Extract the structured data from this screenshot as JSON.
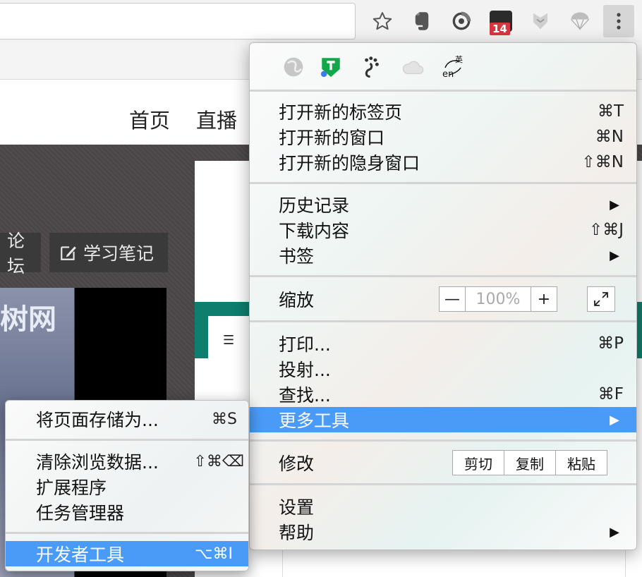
{
  "toolbar": {
    "badge_count": "14",
    "icons": [
      "star-icon",
      "evernote-icon",
      "sync-icon",
      "extension-badge-icon",
      "shield-icon",
      "parachute-icon",
      "menu-dots-icon"
    ]
  },
  "page": {
    "nav": [
      "首页",
      "直播"
    ],
    "buttons": [
      "论坛",
      "学习笔记"
    ],
    "photo_text": "树网"
  },
  "menu": {
    "extension_icons": [
      "ball-icon",
      "tampermonkey-icon",
      "paw-icon",
      "cloud-icon",
      "translate-icon"
    ],
    "translate_label_top": "英",
    "translate_label_bottom": "en",
    "group1": [
      {
        "label": "打开新的标签页",
        "shortcut": "⌘T"
      },
      {
        "label": "打开新的窗口",
        "shortcut": "⌘N"
      },
      {
        "label": "打开新的隐身窗口",
        "shortcut": "⇧⌘N"
      }
    ],
    "group2": [
      {
        "label": "历史记录",
        "arrow": "▶"
      },
      {
        "label": "下载内容",
        "shortcut": "⇧⌘J"
      },
      {
        "label": "书签",
        "arrow": "▶"
      }
    ],
    "zoom": {
      "label": "缩放",
      "minus": "—",
      "value": "100%",
      "plus": "+"
    },
    "group4": [
      {
        "label": "打印...",
        "shortcut": "⌘P"
      },
      {
        "label": "投射..."
      },
      {
        "label": "查找...",
        "shortcut": "⌘F"
      },
      {
        "label": "更多工具",
        "arrow": "▶"
      }
    ],
    "edit": {
      "label": "修改",
      "cut": "剪切",
      "copy": "复制",
      "paste": "粘贴"
    },
    "group6": [
      {
        "label": "设置"
      },
      {
        "label": "帮助",
        "arrow": "▶"
      }
    ]
  },
  "submenu": {
    "items": [
      {
        "label": "将页面存储为...",
        "shortcut": "⌘S"
      },
      {
        "label": "清除浏览数据...",
        "shortcut": "⇧⌘⌫"
      },
      {
        "label": "扩展程序"
      },
      {
        "label": "任务管理器"
      },
      {
        "label": "开发者工具",
        "shortcut": "⌥⌘I"
      }
    ]
  },
  "colors": {
    "highlight": "#4a9bf7",
    "badge": "#d6363f",
    "green": "#0f7e6e"
  }
}
